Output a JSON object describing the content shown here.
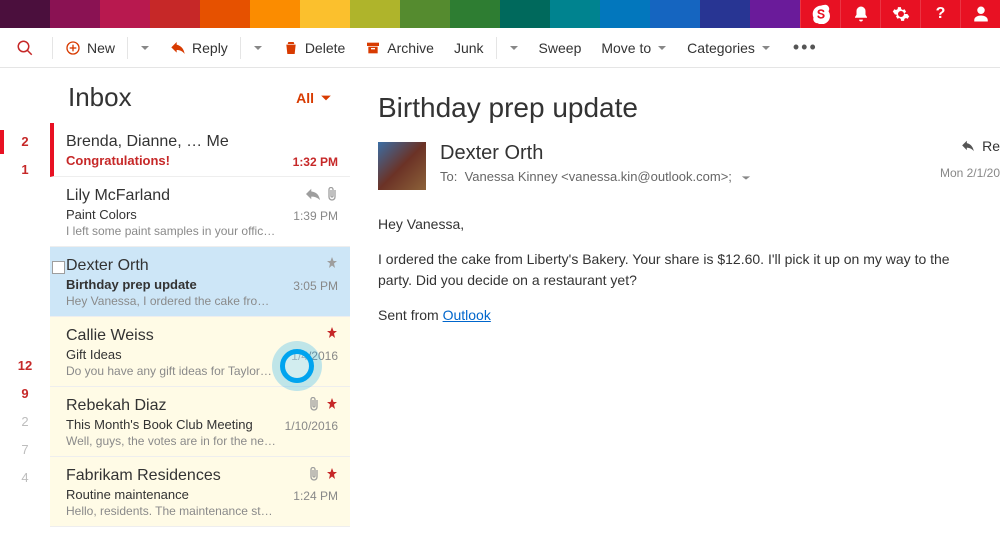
{
  "topnav_colors": [
    "#4b0f3d",
    "#8a1253",
    "#b8194f",
    "#c62828",
    "#e65100",
    "#fb8c00",
    "#fbc02d",
    "#afb42b",
    "#558b2f",
    "#2e7d32",
    "#00695c",
    "#00838f",
    "#0277bd",
    "#1565c0",
    "#283593",
    "#6a1b9a"
  ],
  "toolbar": {
    "new": "New",
    "reply": "Reply",
    "delete": "Delete",
    "archive": "Archive",
    "junk": "Junk",
    "sweep": "Sweep",
    "moveto": "Move to",
    "categories": "Categories"
  },
  "list": {
    "title": "Inbox",
    "filter": "All"
  },
  "rail_counts": [
    {
      "n": "2",
      "class": "red bar"
    },
    {
      "n": "1",
      "class": "red"
    },
    {
      "n": "",
      "class": ""
    },
    {
      "n": "",
      "class": ""
    },
    {
      "n": "",
      "class": ""
    },
    {
      "n": "",
      "class": ""
    },
    {
      "n": "",
      "class": ""
    },
    {
      "n": "",
      "class": ""
    },
    {
      "n": "12",
      "class": "red"
    },
    {
      "n": "9",
      "class": "red"
    },
    {
      "n": "2",
      "class": "gray"
    },
    {
      "n": "7",
      "class": "gray"
    },
    {
      "n": "4",
      "class": "gray"
    }
  ],
  "messages": [
    {
      "sender": "Fabrikam Residences",
      "subject": "Routine maintenance",
      "preview": "Hello, residents. The maintenance staff will…",
      "time": "1:24 PM",
      "class": "yellow",
      "meta": [
        "clip",
        "pin"
      ]
    },
    {
      "sender": "Rebekah Diaz",
      "subject": "This Month's Book Club Meeting",
      "preview": "Well, guys, the votes are in for the new bo…",
      "time": "1/10/2016",
      "class": "yellow",
      "meta": [
        "clip",
        "pin"
      ]
    },
    {
      "sender": "Callie Weiss",
      "subject": "Gift Ideas",
      "preview": "Do you have any gift ideas for Taylor? I wa…",
      "time": "1/4/2016",
      "class": "yellow",
      "meta": [
        "pin"
      ]
    },
    {
      "sender": "Dexter Orth",
      "subject": "Birthday prep update",
      "preview": "Hey Vanessa, I ordered the cake from Liber…",
      "time": "3:05 PM",
      "class": "blue",
      "meta": [
        "pin-gray"
      ],
      "checkbox": true,
      "subjectBold": true,
      "timeRed": false
    },
    {
      "sender": "Lily McFarland",
      "subject": "Paint Colors",
      "preview": "I left some paint samples in your office. Be…",
      "time": "1:39 PM",
      "class": "",
      "meta": [
        "reply",
        "clip"
      ]
    },
    {
      "sender": "Brenda, Dianne, … Me",
      "subject": "Congratulations!",
      "preview": "",
      "time": "1:32 PM",
      "class": "redbar",
      "meta": [],
      "subjectRed": true,
      "timeRed": true
    }
  ],
  "reading": {
    "title": "Birthday prep update",
    "from": "Dexter Orth",
    "to_label": "To:",
    "to": "Vanessa Kinney <vanessa.kin@outlook.com>;",
    "reply": "Re",
    "date": "Mon 2/1/20",
    "greeting": "Hey Vanessa,",
    "body": "I ordered the cake from Liberty's Bakery. Your share is $12.60. I'll pick it up on my way to the party. Did you decide on a restaurant yet?",
    "signature_prefix": "Sent from ",
    "signature_link": "Outlook"
  }
}
